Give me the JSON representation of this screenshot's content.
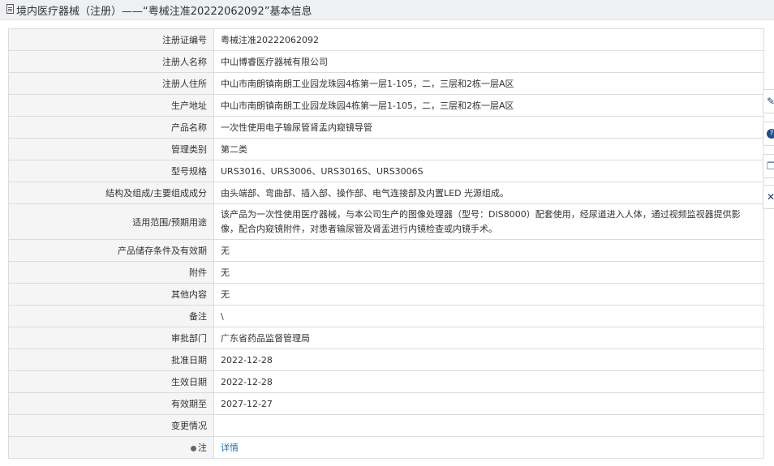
{
  "header": {
    "title": "境内医疗器械（注册）——“粤械注准20222062092”基本信息"
  },
  "rows": [
    {
      "label": "注册证编号",
      "value": "粤械注准20222062092"
    },
    {
      "label": "注册人名称",
      "value": "中山博睿医疗器械有限公司"
    },
    {
      "label": "注册人住所",
      "value": "中山市南朗镇南朗工业园龙珠园4栋第一层1-105，二，三层和2栋一层A区"
    },
    {
      "label": "生产地址",
      "value": "中山市南朗镇南朗工业园龙珠园4栋第一层1-105，二，三层和2栋一层A区"
    },
    {
      "label": "产品名称",
      "value": "一次性使用电子输尿管肾盂内窥镜导管"
    },
    {
      "label": "管理类别",
      "value": "第二类"
    },
    {
      "label": "型号规格",
      "value": "URS3016、URS3006、URS3016S、URS3006S"
    },
    {
      "label": "结构及组成/主要组成成分",
      "value": "由头端部、弯曲部、插入部、操作部、电气连接部及内置LED 光源组成。"
    },
    {
      "label": "适用范围/预期用途",
      "value": "该产品为一次性使用医疗器械，与本公司生产的图像处理器（型号：DIS8000）配套使用，经尿道进入人体，通过视频监视器提供影像，配合内窥镜附件，对患者输尿管及肾盂进行内镜检查或内镜手术。"
    },
    {
      "label": "产品储存条件及有效期",
      "value": "无"
    },
    {
      "label": "附件",
      "value": "无"
    },
    {
      "label": "其他内容",
      "value": "无"
    },
    {
      "label": "备注",
      "value": "\\"
    },
    {
      "label": "审批部门",
      "value": "广东省药品监督管理局"
    },
    {
      "label": "批准日期",
      "value": "2022-12-28"
    },
    {
      "label": "生效日期",
      "value": "2022-12-28"
    },
    {
      "label": "有效期至",
      "value": "2027-12-27"
    },
    {
      "label": "变更情况",
      "value": ""
    },
    {
      "label": "注",
      "value": "详情"
    }
  ],
  "side_tools": [
    {
      "icon": "edit-icon",
      "glyph": "✎"
    },
    {
      "icon": "help-icon",
      "glyph": "?"
    },
    {
      "icon": "copy-icon",
      "glyph": "❐"
    },
    {
      "icon": "close-icon",
      "glyph": "✕"
    }
  ]
}
